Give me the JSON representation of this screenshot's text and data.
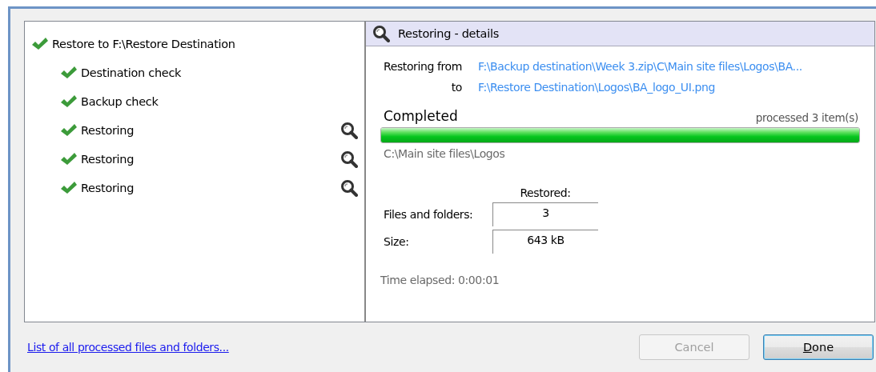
{
  "tree": {
    "label": "Restore to F:\\Restore Destination",
    "done": true,
    "details": false,
    "children": [
      {
        "label": "Destination check",
        "done": true,
        "details": false
      },
      {
        "label": "Backup check",
        "done": true,
        "details": false
      },
      {
        "label": "Restoring",
        "done": true,
        "details": true
      },
      {
        "label": "Restoring",
        "done": true,
        "details": true
      },
      {
        "label": "Restoring",
        "done": true,
        "details": true
      }
    ]
  },
  "details": {
    "title": "Restoring - details",
    "from_label": "Restoring from",
    "from_path": "F:\\Backup destination\\Week 3.zip\\C\\Main site files\\Logos\\BA...",
    "to_label": "to",
    "to_path": "F:\\Restore Destination\\Logos\\BA_logo_UI.png",
    "status": "Completed",
    "processed": "processed 3 item(s)",
    "level": 1,
    "current_folder": "C:\\Main site files\\Logos",
    "column_header": "Restored:",
    "stats": [
      {
        "label": "Files and folders:",
        "value": "3"
      },
      {
        "label": "Size:",
        "value": "643 kB"
      }
    ],
    "elapsed": "Time elapsed: 0:00:01"
  },
  "footer": {
    "link": "List of all processed files and folders...",
    "buttons": [
      {
        "label": "Cancel",
        "disabled": true,
        "default": false
      },
      {
        "label": "Done",
        "disabled": false,
        "default": true
      }
    ]
  }
}
